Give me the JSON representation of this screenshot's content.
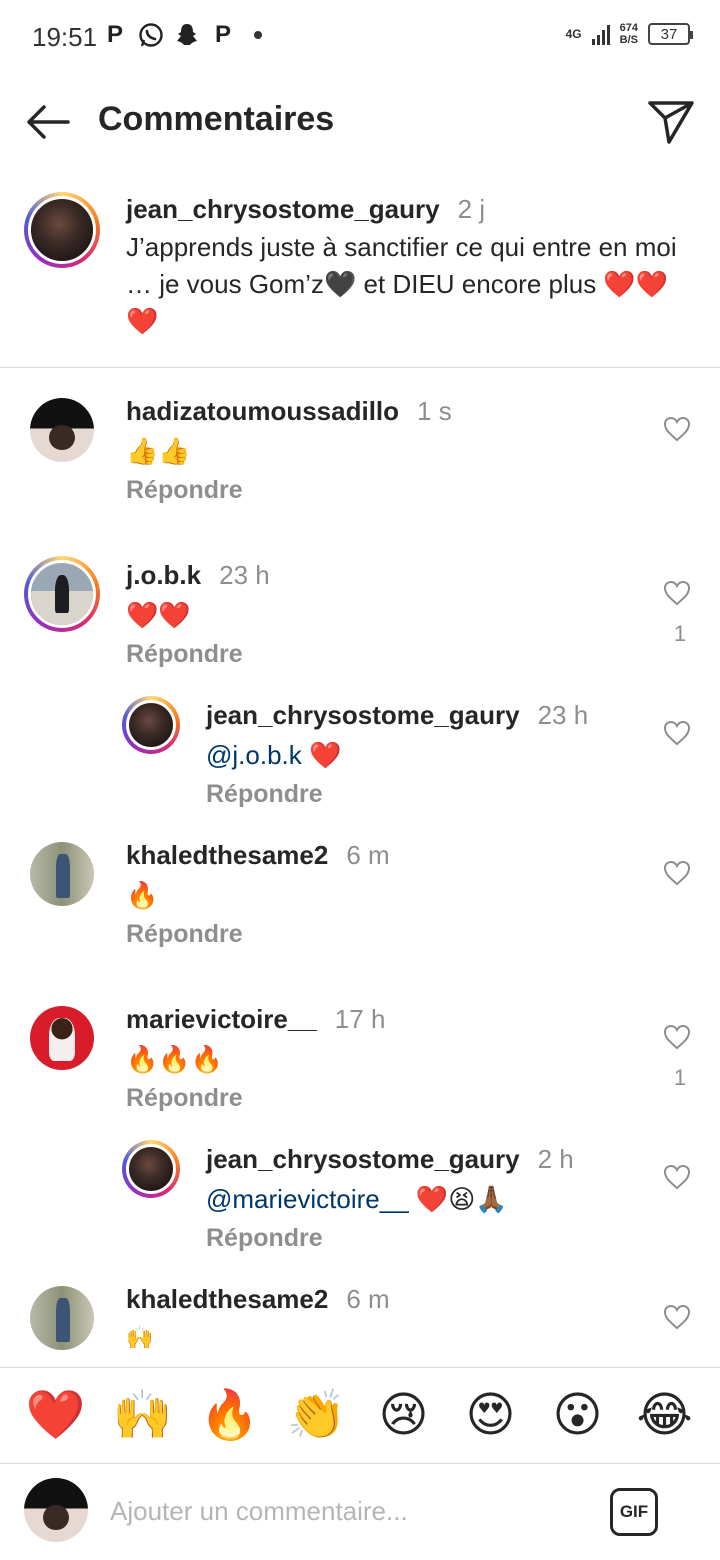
{
  "status_bar": {
    "time": "19:51",
    "notification_icons": [
      "P",
      "whatsapp-icon",
      "snapchat-icon",
      "P"
    ],
    "network": "4G",
    "speed": "674",
    "speed_unit": "B/S",
    "battery": "37"
  },
  "header": {
    "title": "Commentaires"
  },
  "caption": {
    "username": "jean_chrysostome_gaury",
    "time": "2 j",
    "text": "J’apprends juste à sanctifier ce qui entre en moi … je vous Gom’z🖤 et DIEU encore plus ❤️❤️❤️"
  },
  "comments": [
    {
      "username": "hadizatoumoussadillo",
      "time": "1 s",
      "text": "👍👍",
      "reply_label": "Répondre",
      "likes": ""
    },
    {
      "username": "j.o.b.k",
      "time": "23 h",
      "text": "❤️❤️",
      "reply_label": "Répondre",
      "likes": "1"
    },
    {
      "username": "jean_chrysostome_gaury",
      "time": "23 h",
      "mention": "@j.o.b.k",
      "text": " ❤️",
      "reply_label": "Répondre",
      "likes": ""
    },
    {
      "username": "khaledthesame2",
      "time": "6 m",
      "text": "🔥",
      "reply_label": "Répondre",
      "likes": ""
    },
    {
      "username": "marievictoire__",
      "time": "17 h",
      "text": "🔥🔥🔥",
      "reply_label": "Répondre",
      "likes": "1"
    },
    {
      "username": "jean_chrysostome_gaury",
      "time": "2 h",
      "mention": "@marievictoire__",
      "text": " ❤️😫🙏🏾",
      "reply_label": "Répondre",
      "likes": ""
    },
    {
      "username": "khaledthesame2",
      "time": "6 m",
      "text": "🙌",
      "reply_label": "",
      "likes": ""
    }
  ],
  "emoji_bar": [
    "❤️",
    "🙌",
    "🔥",
    "👏",
    "😢",
    "😍",
    "😮",
    "😂"
  ],
  "input": {
    "placeholder": "Ajouter un commentaire...",
    "gif_label": "GIF"
  },
  "colors": {
    "text": "#262626",
    "muted": "#8e8e8e",
    "mention": "#00376b",
    "divider": "#dbdbdb"
  }
}
